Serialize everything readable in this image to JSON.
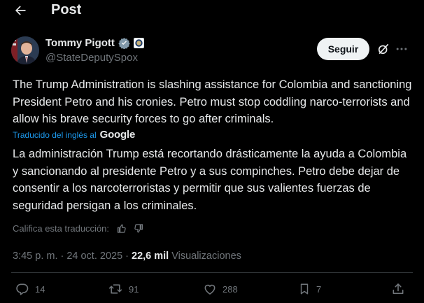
{
  "header": {
    "title": "Post"
  },
  "author": {
    "name": "Tommy Pigott",
    "handle": "@StateDeputySpox",
    "follow_label": "Seguir"
  },
  "post": {
    "original_text": "The Trump Administration is slashing assistance for Colombia and sanctioning President Petro and his cronies. Petro must stop coddling narco-terrorists and allow his brave security forces to go after criminals.",
    "translated_label": "Traducido del inglés al",
    "translator": "Google",
    "translated_text": "La administración Trump está recortando drásticamente la ayuda a Colombia y sancionando al presidente Petro y a sus compinches. Petro debe dejar de consentir a los narcoterroristas y permitir que sus valientes fuerzas de seguridad persigan a los criminales.",
    "rate_label": "Califica esta traducción:",
    "time": "3:45 p. m.",
    "sep1": "·",
    "date": "24 oct. 2025",
    "sep2": "·",
    "views": "22,6 mil",
    "views_label": "Visualizaciones"
  },
  "actions": {
    "replies": "14",
    "reposts": "91",
    "likes": "288",
    "bookmarks": "7"
  },
  "colors": {
    "background": "#000000",
    "text": "#e7e9ea",
    "muted": "#71767b",
    "accent": "#1d9bf0",
    "verified": "#829aab"
  },
  "icons": [
    "back-arrow-icon",
    "verified-badge-icon",
    "affiliate-seal-icon",
    "grok-icon",
    "more-icon",
    "thumbs-up-icon",
    "thumbs-down-icon",
    "reply-icon",
    "repost-icon",
    "like-icon",
    "bookmark-icon",
    "share-icon"
  ]
}
